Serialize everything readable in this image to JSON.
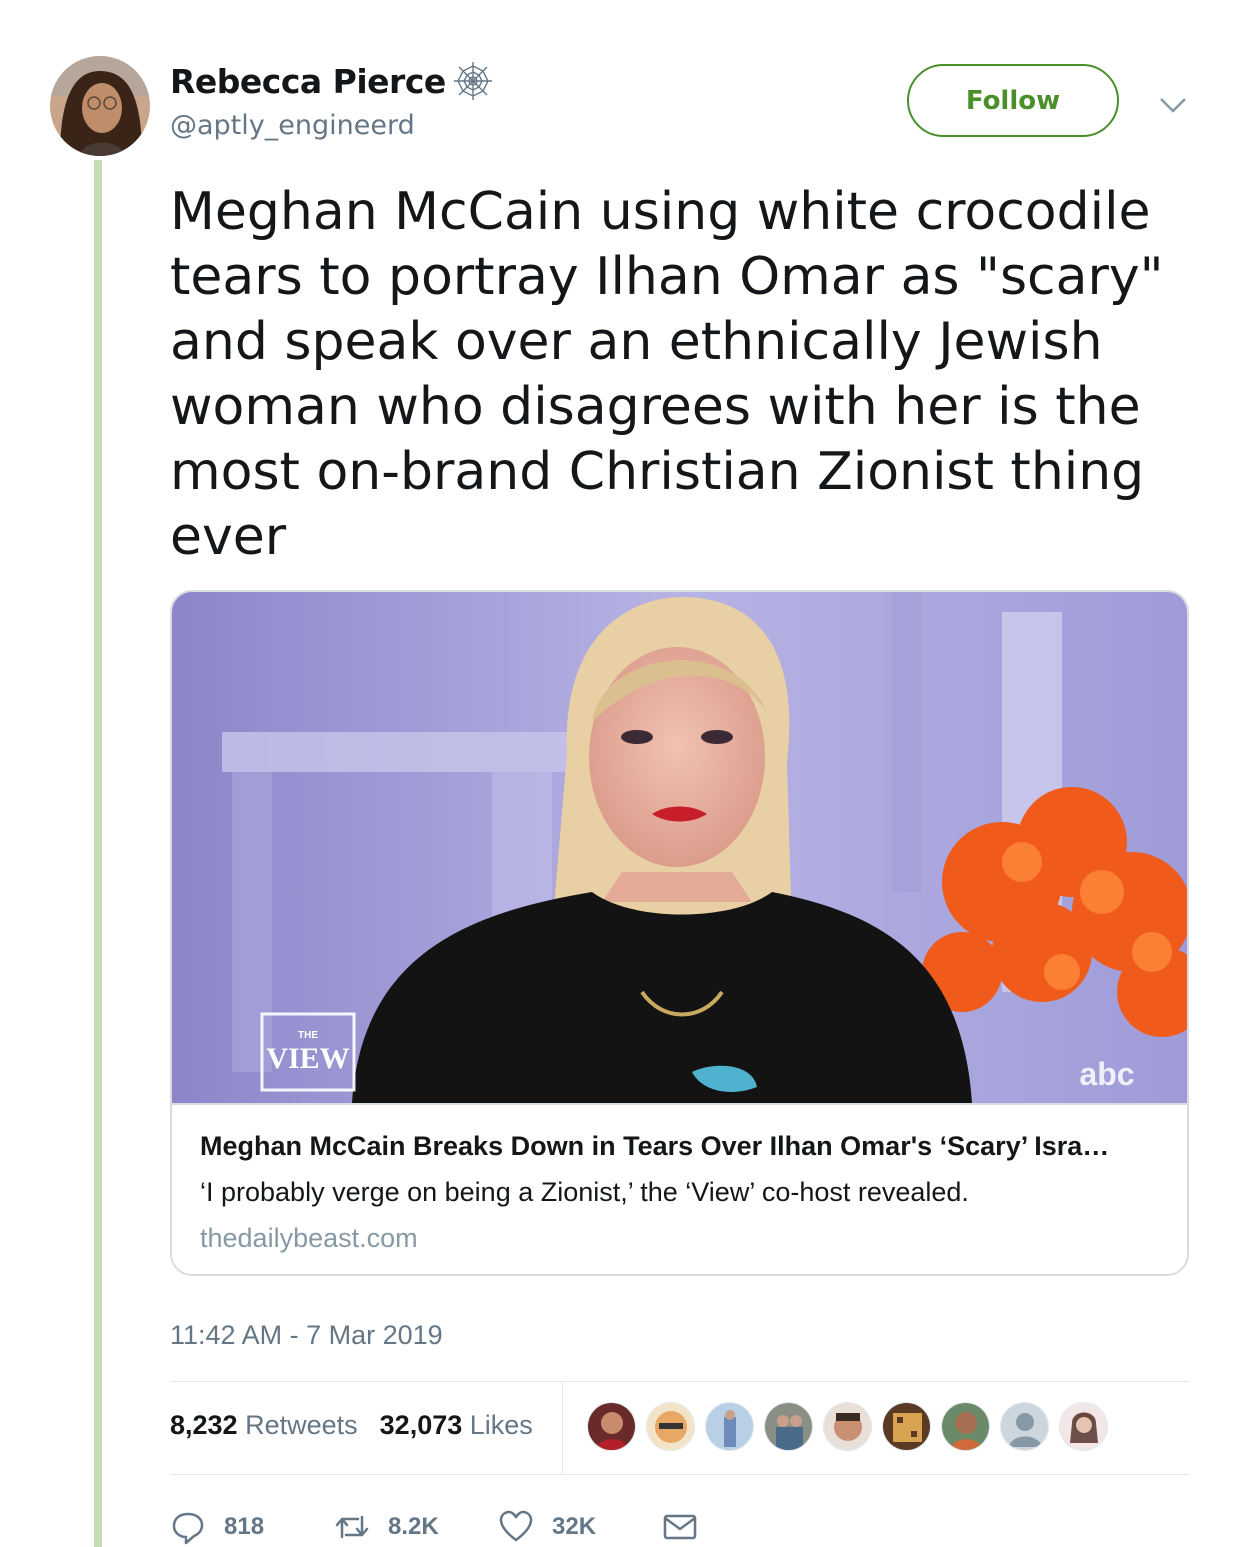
{
  "user": {
    "display_name": "Rebecca Pierce",
    "handle": "@aptly_engineerd",
    "badge_icon": "spiderweb-icon"
  },
  "follow_label": "Follow",
  "tweet": {
    "text": "Meghan McCain using white crocodile tears to portray Ilhan Omar as \"scary\" and speak over an ethnically Jewish woman who disagrees with her is the most on-brand Christian Zionist thing ever",
    "timestamp": "11:42 AM - 7 Mar 2019"
  },
  "card": {
    "title": "Meghan McCain Breaks Down in Tears Over Ilhan Omar's ‘Scary’ Isra…",
    "description": "‘I probably verge on being a Zionist,’ the ‘View’ co-host revealed.",
    "domain": "thedailybeast.com",
    "image": {
      "show_logo_top": "THE",
      "show_logo_main": "VIEW",
      "network_logo": "abc"
    }
  },
  "stats": {
    "retweets_count": "8,232",
    "retweets_label": "Retweets",
    "likes_count": "32,073",
    "likes_label": "Likes"
  },
  "actions": {
    "replies": "818",
    "retweets": "8.2K",
    "likes": "32K"
  },
  "colors": {
    "accent": "#4a8f2a",
    "thread_line": "#c5dcb6",
    "muted": "#657786",
    "border": "#d5dde2"
  }
}
